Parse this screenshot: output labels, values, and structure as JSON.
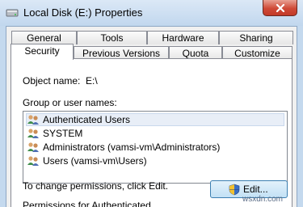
{
  "window": {
    "title": "Local Disk (E:) Properties"
  },
  "tabs_back": [
    "General",
    "Tools",
    "Hardware",
    "Sharing"
  ],
  "tabs_front": [
    "Security",
    "Previous Versions",
    "Quota",
    "Customize"
  ],
  "active_tab": "Security",
  "object_name": {
    "label": "Object name:",
    "value": "E:\\"
  },
  "groups": {
    "label": "Group or user names:",
    "items": [
      "Authenticated Users",
      "SYSTEM",
      "Administrators (vamsi-vm\\Administrators)",
      "Users (vamsi-vm\\Users)"
    ],
    "selected_index": 0
  },
  "change_hint": "To change permissions, click Edit.",
  "edit_button": "Edit...",
  "permissions_label": "Permissions for Authenticated",
  "watermark": "wsxdn.com"
}
